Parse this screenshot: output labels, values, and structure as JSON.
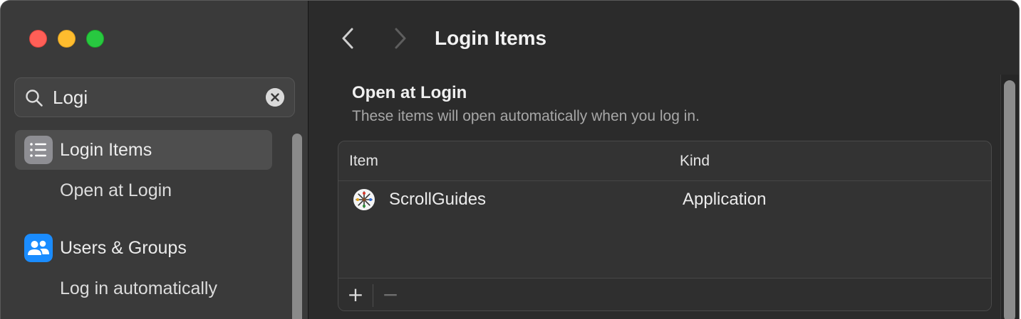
{
  "window": {
    "traffic_lights": [
      "close",
      "minimize",
      "zoom"
    ]
  },
  "sidebar": {
    "search": {
      "value": "Logi",
      "icon": "magnifying-glass-icon",
      "clear_icon": "clear-x-icon"
    },
    "items": [
      {
        "label": "Login Items",
        "icon": "list-icon",
        "icon_color": "#8e8e93",
        "selected": true,
        "sub_items": [
          "Open at Login"
        ]
      },
      {
        "label": "Users & Groups",
        "icon": "people-icon",
        "icon_color": "#1a8cff",
        "selected": false,
        "sub_items": [
          "Log in automatically"
        ]
      }
    ]
  },
  "main": {
    "title": "Login Items",
    "nav": {
      "back_icon": "chevron-left-icon",
      "forward_icon": "chevron-right-icon"
    },
    "section": {
      "title": "Open at Login",
      "subtitle": "These items will open automatically when you log in."
    },
    "table": {
      "columns": [
        "Item",
        "Kind"
      ],
      "rows": [
        {
          "item": "ScrollGuides",
          "kind": "Application",
          "icon": "scrollguides-app-icon"
        }
      ],
      "add_label": "+",
      "remove_label": "−"
    }
  },
  "colors": {
    "sidebar_bg": "#3a3a3a",
    "content_bg": "#2b2b2b",
    "selection_bg": "#4e4e4e",
    "accent_blue": "#1a8cff"
  }
}
